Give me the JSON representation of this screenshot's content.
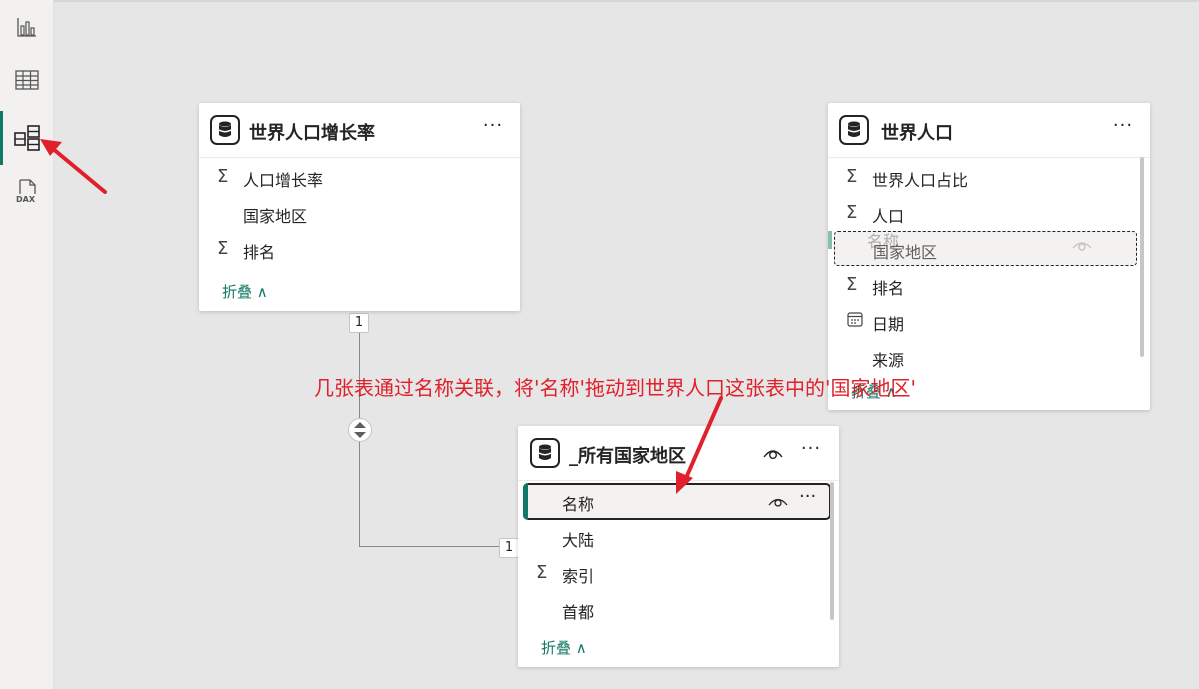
{
  "sidebar": {
    "items": [
      {
        "name": "report-view",
        "icon": "bar-chart-icon"
      },
      {
        "name": "table-view",
        "icon": "table-grid-icon"
      },
      {
        "name": "model-view",
        "icon": "model-view-icon",
        "active": true
      },
      {
        "name": "dax-query-view",
        "icon": "dax-icon",
        "label": "DAX"
      }
    ]
  },
  "tables": {
    "growth": {
      "title": "世界人口增长率",
      "fields": [
        {
          "label": "人口增长率",
          "sigma": "Σ"
        },
        {
          "label": "国家地区",
          "sigma": ""
        },
        {
          "label": "排名",
          "sigma": "Σ"
        }
      ],
      "collapse": "折叠 ∧"
    },
    "population": {
      "title": "世界人口",
      "fields": [
        {
          "label": "世界人口占比",
          "sigma": "Σ"
        },
        {
          "label": "人口",
          "sigma": "Σ"
        },
        {
          "label": "国家地区",
          "ghost": "名称"
        },
        {
          "label": "排名",
          "sigma": "Σ"
        },
        {
          "label": "日期",
          "icon": "calendar-icon"
        },
        {
          "label": "来源",
          "sigma": ""
        }
      ],
      "collapse": "折叠 ∧"
    },
    "countries": {
      "title": "_所有国家地区",
      "fields": [
        {
          "label": "名称",
          "sigma": ""
        },
        {
          "label": "大陆",
          "sigma": ""
        },
        {
          "label": "索引",
          "sigma": "Σ"
        },
        {
          "label": "首都",
          "sigma": ""
        }
      ],
      "collapse": "折叠 ∧"
    }
  },
  "relationship": {
    "from_cardinality": "1",
    "to_cardinality": "1"
  },
  "annotation": {
    "text": "几张表通过名称关联，将'名称'拖动到世界人口这张表中的'国家地区'",
    "color": "#e0202a"
  },
  "colors": {
    "accent": "#117865",
    "arrow": "#e0202a"
  }
}
